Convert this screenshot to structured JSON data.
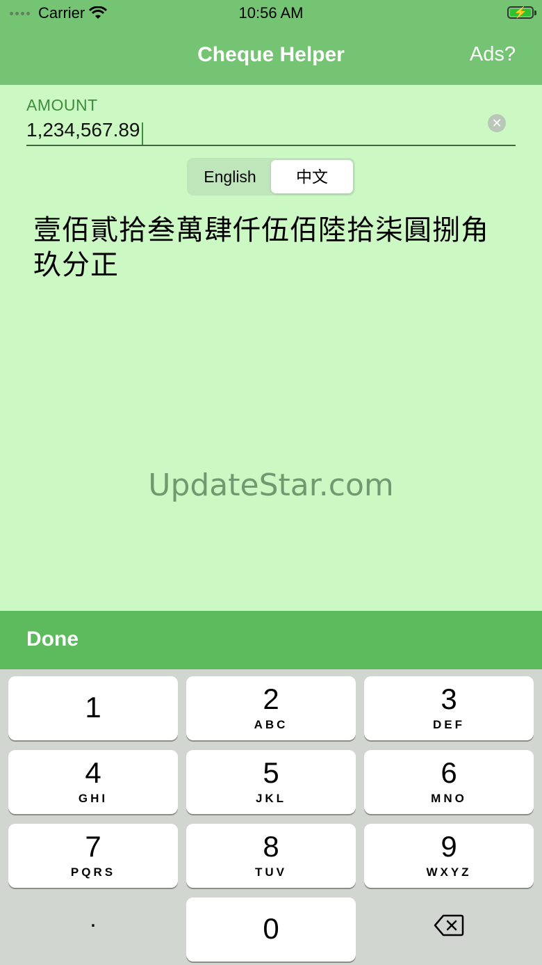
{
  "status_bar": {
    "carrier": "Carrier",
    "time": "10:56 AM",
    "wifi_icon": "wifi-icon",
    "battery_icon": "battery-charging-icon"
  },
  "nav": {
    "title": "Cheque Helper",
    "right_button": "Ads?"
  },
  "amount": {
    "label": "AMOUNT",
    "value": "1,234,567.89",
    "clear_icon": "clear-circle-icon",
    "clear_glyph": "✕"
  },
  "language_segment": {
    "options": [
      "English",
      "中文"
    ],
    "selected": "中文"
  },
  "result_text": "壹佰貳拾叁萬肆仟伍佰陸拾柒圓捌角玖分正",
  "watermark": "UpdateStar.com",
  "accessory": {
    "done_label": "Done"
  },
  "keypad": {
    "keys": [
      {
        "num": "1",
        "letters": ""
      },
      {
        "num": "2",
        "letters": "ABC"
      },
      {
        "num": "3",
        "letters": "DEF"
      },
      {
        "num": "4",
        "letters": "GHI"
      },
      {
        "num": "5",
        "letters": "JKL"
      },
      {
        "num": "6",
        "letters": "MNO"
      },
      {
        "num": "7",
        "letters": "PQRS"
      },
      {
        "num": "8",
        "letters": "TUV"
      },
      {
        "num": "9",
        "letters": "WXYZ"
      },
      {
        "num": "0",
        "letters": ""
      }
    ],
    "decimal": ".",
    "delete_icon": "backspace-icon"
  },
  "colors": {
    "nav_green": "#74c474",
    "background": "#ccf9c3",
    "done_bar": "#5dba5d",
    "keyboard_bg": "#d2d6d0"
  }
}
